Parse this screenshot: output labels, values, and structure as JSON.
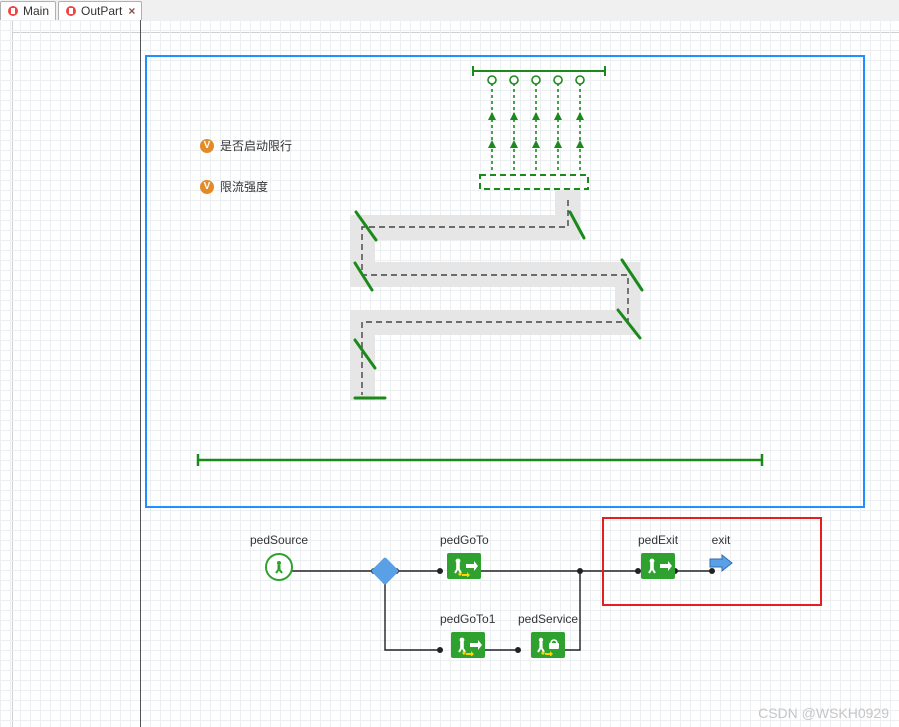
{
  "tabs": [
    {
      "label": "Main",
      "active": false
    },
    {
      "label": "OutPart",
      "active": true
    }
  ],
  "params": {
    "p1": "是否启动限行",
    "p2": "限流强度"
  },
  "flow": {
    "pedSource": "pedSource",
    "pedGoTo": "pedGoTo",
    "pedGoTo1": "pedGoTo1",
    "pedService": "pedService",
    "pedExit": "pedExit",
    "exit": "exit"
  },
  "watermark": "CSDN @WSKH0929",
  "colors": {
    "frame": "#1e90ff",
    "highlight": "#e61e1e",
    "pedBlock": "#2ea12e",
    "paramIcon": "#e38b27"
  }
}
